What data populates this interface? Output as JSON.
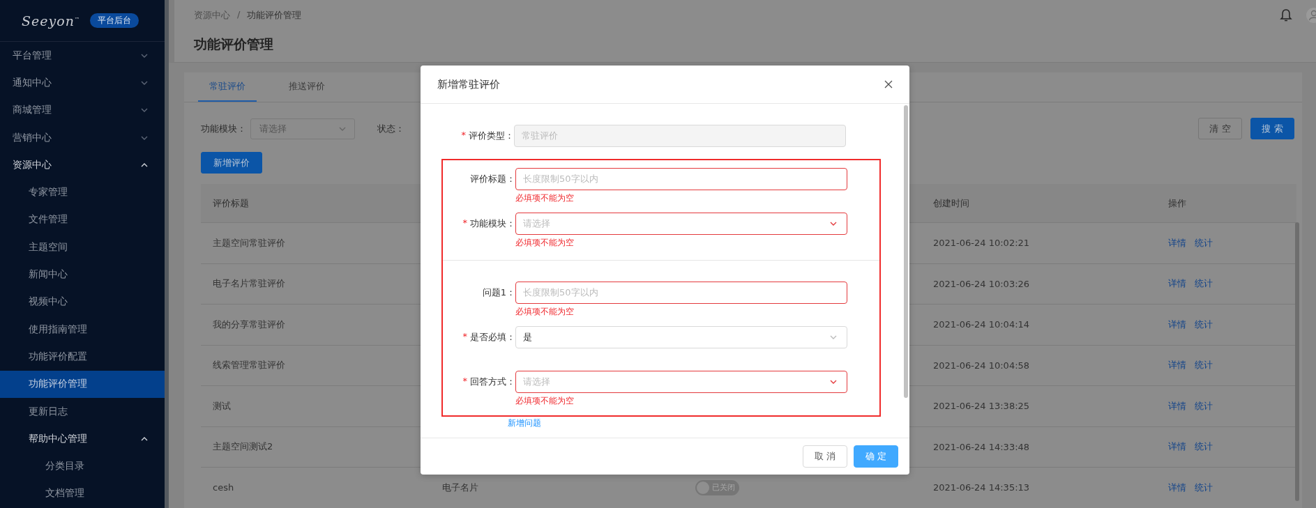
{
  "sidebar": {
    "logo": {
      "text": "Seeyon",
      "mark": "™"
    },
    "badge": "平台后台",
    "items": [
      {
        "label": "平台管理",
        "expanded": false,
        "selected": false
      },
      {
        "label": "通知中心",
        "expanded": false,
        "selected": false
      },
      {
        "label": "商城管理",
        "expanded": false,
        "selected": false
      },
      {
        "label": "营销中心",
        "expanded": false,
        "selected": false
      },
      {
        "label": "资源中心",
        "expanded": true,
        "selected": false,
        "children": [
          {
            "label": "专家管理",
            "selected": false
          },
          {
            "label": "文件管理",
            "selected": false
          },
          {
            "label": "主题空间",
            "selected": false
          },
          {
            "label": "新闻中心",
            "selected": false
          },
          {
            "label": "视频中心",
            "selected": false
          },
          {
            "label": "使用指南管理",
            "selected": false
          },
          {
            "label": "功能评价配置",
            "selected": false
          },
          {
            "label": "功能评价管理",
            "selected": true
          },
          {
            "label": "更新日志",
            "selected": false
          },
          {
            "label": "帮助中心管理",
            "expanded": true,
            "selected": false,
            "children": [
              {
                "label": "分类目录",
                "selected": false
              },
              {
                "label": "文档管理",
                "selected": false
              }
            ]
          }
        ]
      }
    ]
  },
  "breadcrumb": [
    "资源中心",
    "功能评价管理"
  ],
  "breadcrumb_separator": "/",
  "page_title": "功能评价管理",
  "tabs": [
    {
      "label": "常驻评价",
      "selected": true
    },
    {
      "label": "推送评价",
      "selected": false
    }
  ],
  "filters": [
    {
      "label": "功能模块：",
      "placeholder": "请选择"
    },
    {
      "label": "状态："
    }
  ],
  "filter_buttons": [
    {
      "label": "清 空",
      "kind": "secondary"
    },
    {
      "label": "搜 索",
      "kind": "primary"
    }
  ],
  "add_button": "新增评价",
  "table": {
    "columns": [
      {
        "label": "评价标题"
      },
      {
        "label": "创建时间"
      },
      {
        "label": "操作"
      }
    ],
    "rows": [
      {
        "title": "主题空间常驻评价",
        "created": "2021-06-24 10:02:21",
        "actions": [
          "详情",
          "统计"
        ]
      },
      {
        "title": "电子名片常驻评价",
        "created": "2021-06-24 10:03:26",
        "actions": [
          "详情",
          "统计"
        ]
      },
      {
        "title": "我的分享常驻评价",
        "created": "2021-06-24 10:04:14",
        "actions": [
          "详情",
          "统计"
        ]
      },
      {
        "title": "线索管理常驻评价",
        "created": "2021-06-24 10:04:58",
        "actions": [
          "详情",
          "统计"
        ]
      },
      {
        "title": "测试",
        "created": "2021-06-24 13:38:25",
        "actions": [
          "详情",
          "统计"
        ]
      },
      {
        "title": "主题空间测试2",
        "created": "2021-06-24 14:33:48",
        "actions": [
          "详情",
          "统计"
        ]
      },
      {
        "title": "cesh",
        "module": "电子名片",
        "status": {
          "on": false,
          "label": "已关闭"
        },
        "created": "2021-06-24 14:35:13",
        "actions": [
          "详情",
          "统计"
        ]
      }
    ]
  },
  "modal": {
    "title": "新增常驻评价",
    "fields": [
      {
        "label": "评价类型：",
        "required": true,
        "kind": "input",
        "disabled": true,
        "value": "常驻评价"
      }
    ],
    "highlighted_group": {
      "highlighted": true,
      "sections": [
        {
          "fields": [
            {
              "label": "评价标题：",
              "required": false,
              "kind": "input",
              "disabled": false,
              "placeholder": "长度限制50字以内",
              "error": "必填项不能为空"
            },
            {
              "label": "功能模块：",
              "required": true,
              "kind": "select",
              "disabled": false,
              "placeholder": "请选择",
              "error": "必填项不能为空"
            }
          ]
        },
        {
          "fields": [
            {
              "label": "问题1：",
              "required": false,
              "kind": "input",
              "disabled": false,
              "placeholder": "长度限制50字以内",
              "error": "必填项不能为空"
            },
            {
              "label": "是否必填：",
              "required": true,
              "kind": "select",
              "disabled": false,
              "value": "是"
            },
            {
              "label": "回答方式：",
              "required": true,
              "kind": "select",
              "disabled": false,
              "placeholder": "请选择",
              "error": "必填项不能为空"
            }
          ]
        }
      ]
    },
    "add_question_link": "新增问题",
    "required_mark": "*",
    "buttons": [
      {
        "label": "取 消",
        "kind": "secondary"
      },
      {
        "label": "确 定",
        "kind": "primary"
      }
    ]
  }
}
